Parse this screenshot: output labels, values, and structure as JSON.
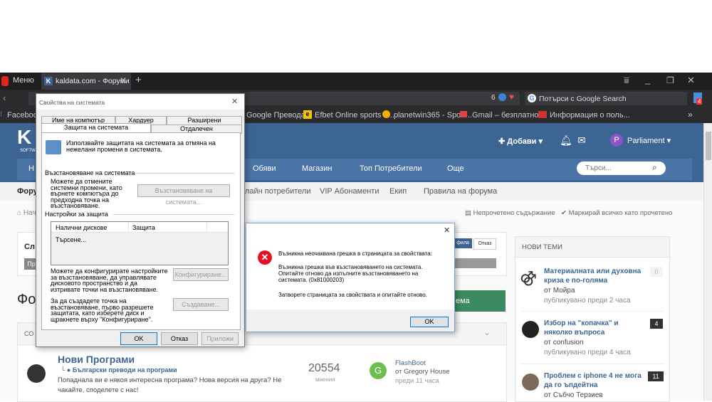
{
  "browser": {
    "menu_label": "Меню",
    "tab_title": "kaldata.com - Форуми",
    "tab_favicon": "K",
    "new_tab": "+",
    "notif_count": "6",
    "search_placeholder": "Потърси с Google Search",
    "ext_badge": "4",
    "more": "»",
    "bookmarks": [
      {
        "icon": "facebook-icon",
        "label": "Facebook"
      },
      {
        "icon": "google-translate-icon",
        "label": "Google Преводач"
      },
      {
        "icon": "efbet-icon",
        "label": "Efbet Online sports b..."
      },
      {
        "icon": "planetwin-icon",
        "label": "planetwin365 - Sport..."
      },
      {
        "icon": "gmail-icon",
        "label": "Gmail – безплатно ..."
      },
      {
        "icon": "live-icon",
        "label": "Информация о поль..."
      }
    ]
  },
  "site": {
    "logo": "K",
    "logo_sub": "SOFTWA",
    "add_label": "Добави",
    "user_initial": "P",
    "user_name": "Parliament",
    "nav_first": "Н",
    "nav_items": [
      "Обяви",
      "Магазин",
      "Топ Потребители",
      "Още"
    ],
    "search_placeholder": "Търси...",
    "subnav_first": "Фору",
    "subnav_items": [
      "лайн потребители",
      "VIP Абонаменти",
      "Екип",
      "Правила на форума"
    ],
    "breadcrumb_home": "Нач",
    "unread": "Непрочетено съдържание",
    "mark_read": "Маркирай всичко като прочетено",
    "left_box_title": "Сл",
    "left_box_btn": "Пр",
    "forum_heading": "Фо",
    "section_head": "СО",
    "cookie_accept": "фила",
    "cookie_decline": "Отказ",
    "create_btn_tail": "ема"
  },
  "forum_row": {
    "title": "Нови Програми",
    "subforum": "Български преводи на програми",
    "desc": "Попаднала ви е някоя интересна програма? Нова версия на друга? Не чакайте, споделете с нас!",
    "count": "20554",
    "count_label": "мнения",
    "last_avatar": "G",
    "last_title": "FlashBoot",
    "last_by": "от Gregory House",
    "last_time": "преди 11 часа"
  },
  "sidebar": {
    "title": "НОВИ ТЕМИ",
    "topics": [
      {
        "title": "Материалната или духовна криза е по-голяма",
        "by": "от Мойра",
        "time": "публикувано преди 2 часа",
        "count": "0"
      },
      {
        "title": "Избор на \"копачка\" и няколко въпроса",
        "by": "от confusion",
        "time": "публикувано преди 4 часа",
        "count": "4"
      },
      {
        "title": "Проблем с iphone 4 не мога да го ъпдейтна",
        "by": "от Събчо Терзиев",
        "time": "",
        "count": "11"
      }
    ]
  },
  "sysprops": {
    "title": "Свойства на системата",
    "close": "✕",
    "tabs_row1": [
      "Име на компютър",
      "Хардуер",
      "Разширени"
    ],
    "tabs_row2": [
      "Защита на системата",
      "Отдалечен"
    ],
    "intro": "Използвайте защитата на системата за отмяна на нежелани промени в системата.",
    "restore_group": "Възстановяване на системата",
    "restore_text": "Можете да отмените системни промени, като върнете компютъра до предходна точка на възстановяване.",
    "restore_btn": "Възстановяване на системата...",
    "protection_group": "Настройки за защита",
    "col_drives": "Налични дискове",
    "col_protection": "Защита",
    "searching": "Търсене...",
    "config_text": "Можете да конфигурирате настройките за възстановяване, да управлявате дисковото пространство и да изтривате точки на възстановяване.",
    "config_btn": "Конфигуриране...",
    "create_text": "За да създадете точка на възстановяване, първо разрешете защитата, като изберете диск и щракнете върху \"Конфигуриране\".",
    "create_btn": "Създаване...",
    "ok": "OK",
    "cancel": "Отказ",
    "apply": "Приложи"
  },
  "error_dialog": {
    "close": "✕",
    "headline": "Възникна неочаквана грешка в страницата за свойствата:",
    "detail": "Възникна грешка във възстановяването на системата. Опитайте отново да изпълните възстановяването на системата. (0x81000203)",
    "advice": "Затворете страницата за свойствата и опитайте отново.",
    "ok": "OK"
  }
}
